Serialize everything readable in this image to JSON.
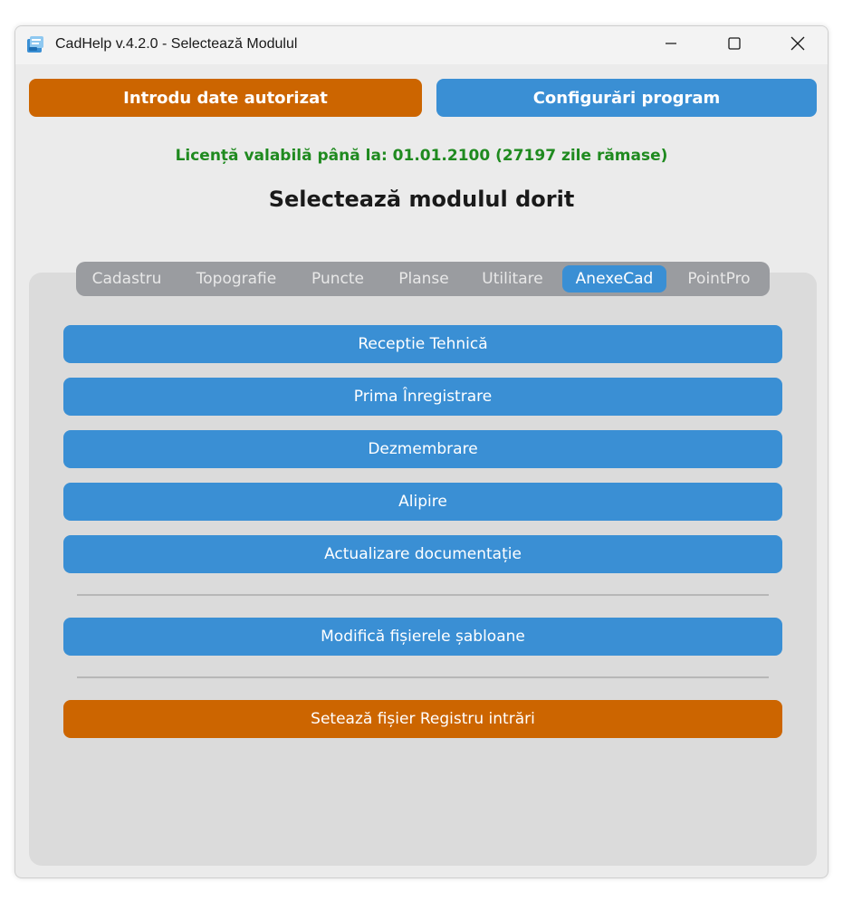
{
  "window": {
    "title": "CadHelp v.4.2.0 - Selectează Modulul",
    "icons": {
      "app": "cadhelp-app-icon",
      "minimize": "minimize-icon",
      "maximize": "maximize-icon",
      "close": "close-icon"
    }
  },
  "header": {
    "auth_button": "Introdu date autorizat",
    "config_button": "Configurări program",
    "license_text": "Licență valabilă până la: 01.01.2100 (27197 zile rămase)",
    "heading": "Selectează modulul dorit"
  },
  "tabs": [
    {
      "label": "Cadastru",
      "active": false
    },
    {
      "label": "Topografie",
      "active": false
    },
    {
      "label": "Puncte",
      "active": false
    },
    {
      "label": "Planse",
      "active": false
    },
    {
      "label": "Utilitare",
      "active": false
    },
    {
      "label": "AnexeCad",
      "active": true
    },
    {
      "label": "PointPro",
      "active": false
    }
  ],
  "modules": [
    {
      "label": "Receptie Tehnică"
    },
    {
      "label": "Prima Înregistrare"
    },
    {
      "label": "Dezmembrare"
    },
    {
      "label": "Alipire"
    },
    {
      "label": "Actualizare documentație"
    }
  ],
  "templates_button": "Modifică fișierele șabloane",
  "registry_button": "Setează fișier Registru intrări",
  "colors": {
    "orange": "#cc6500",
    "blue": "#3a8fd4",
    "license_green": "#1f8a1f",
    "tabbar_gray": "#9a9ca0",
    "panel_gray": "#dbdbdb",
    "window_bg": "#ebebeb"
  }
}
